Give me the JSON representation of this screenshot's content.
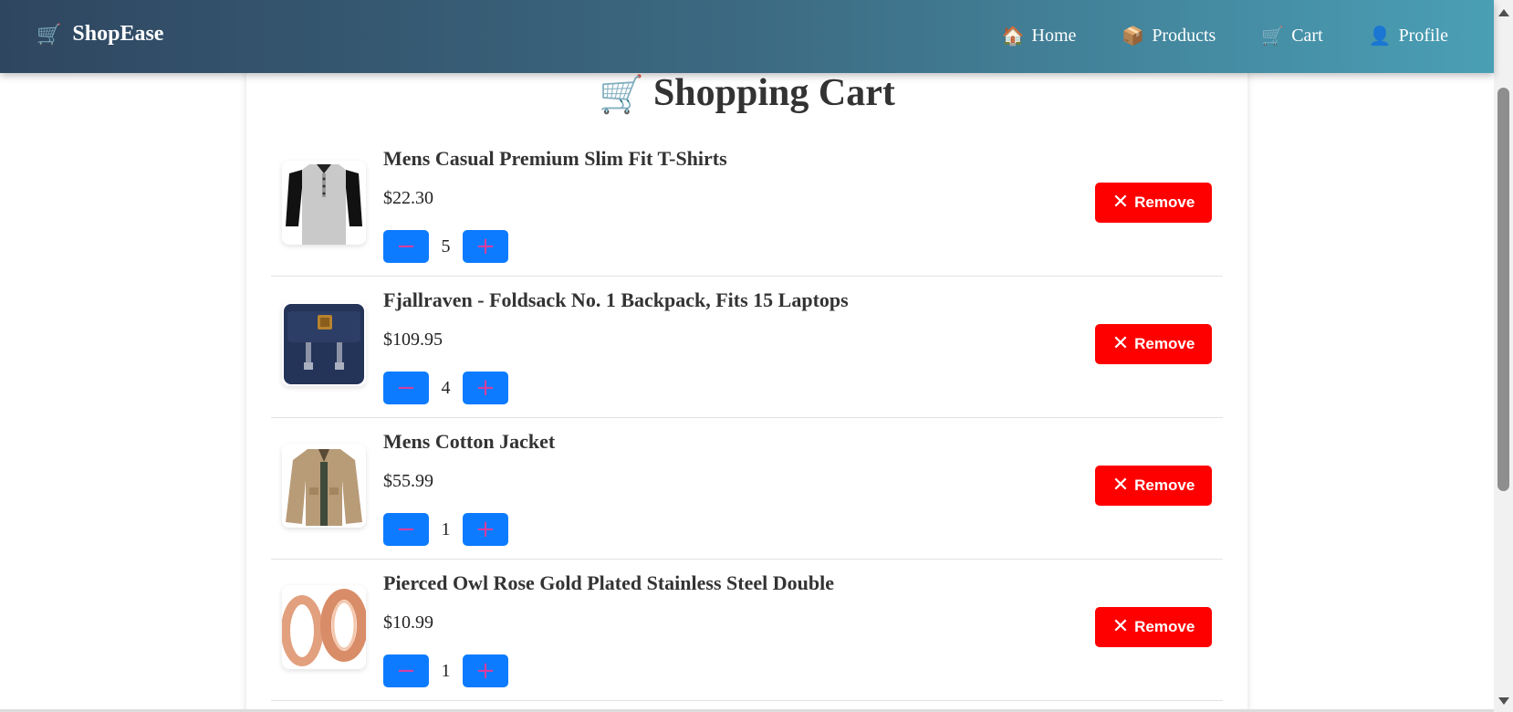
{
  "brand": {
    "name": "ShopEase",
    "icon": "🛒"
  },
  "nav": [
    {
      "label": "Home",
      "icon": "🏠"
    },
    {
      "label": "Products",
      "icon": "📦"
    },
    {
      "label": "Cart",
      "icon": "🛒"
    },
    {
      "label": "Profile",
      "icon": "👤"
    }
  ],
  "cart": {
    "title": "Shopping Cart",
    "title_icon": "🛒",
    "minus_label": "−",
    "plus_label": "+",
    "remove_label": "Remove",
    "remove_icon": "✕",
    "items": [
      {
        "name": "Mens Casual Premium Slim Fit T-Shirts",
        "price": "$22.30",
        "qty": "5",
        "image": "tshirt-image"
      },
      {
        "name": "Fjallraven - Foldsack No. 1 Backpack, Fits 15 Laptops",
        "price": "$109.95",
        "qty": "4",
        "image": "backpack-image"
      },
      {
        "name": "Mens Cotton Jacket",
        "price": "$55.99",
        "qty": "1",
        "image": "jacket-image"
      },
      {
        "name": "Pierced Owl Rose Gold Plated Stainless Steel Double",
        "price": "$10.99",
        "qty": "1",
        "image": "rings-image"
      }
    ]
  },
  "colors": {
    "remove": "#ff0000",
    "qty_button": "#0d7bff",
    "nav_start": "#2f4660",
    "nav_end": "#4a9fb5"
  }
}
